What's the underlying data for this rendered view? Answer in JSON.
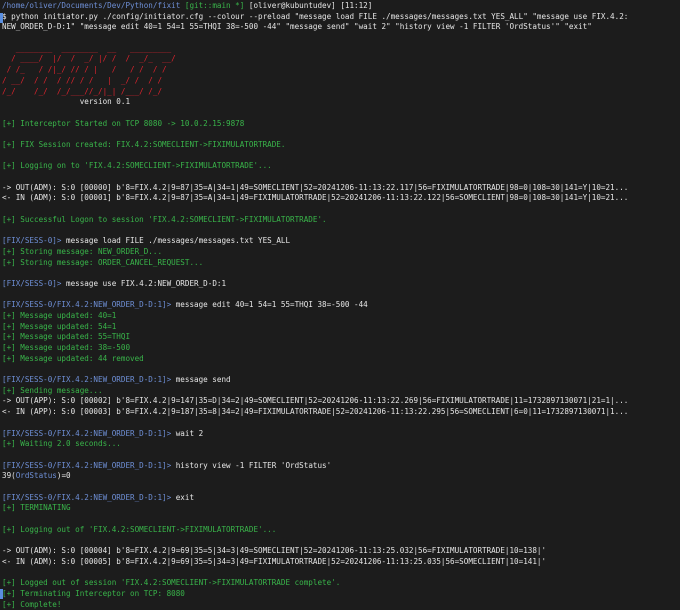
{
  "terminal": {
    "lines": [
      [
        {
          "t": "/home/oliver/Documents/Dev/Python/fixit",
          "c": "blue"
        },
        {
          "t": " [git::main *] ",
          "c": "green"
        },
        {
          "t": "[oliver@kubuntudev] [11:12]",
          "c": "white"
        }
      ],
      [
        {
          "t": "$ python initiator.py ./config/initiator.cfg --colour --preload \"message load FILE ./messages/messages.txt YES_ALL\" \"message use FIX.4.2:",
          "c": "white"
        }
      ],
      [
        {
          "t": "NEW_ORDER_D-D:1\" \"message edit 40=1 54=1 55=THQI 38=-500 -44\" \"message send\" \"wait 2\" \"history view -1 FILTER 'OrdStatus'\" \"exit\"",
          "c": "white"
        }
      ],
      [],
      [
        {
          "t": "   ________  ________  __   _________",
          "c": "red"
        }
      ],
      [
        {
          "t": "  / ____/  |/  /  _/ |/ /  /  _/_  __/",
          "c": "red"
        }
      ],
      [
        {
          "t": " / /_   / /|_/ // / |   /   / /  / /",
          "c": "red"
        }
      ],
      [
        {
          "t": "/ __/  / /  / // / /   |  _/ /  / /",
          "c": "red"
        }
      ],
      [
        {
          "t": "/_/    /_/  /_/___//_/|_| /___/ /_/",
          "c": "red"
        }
      ],
      [
        {
          "t": "                 version 0.1",
          "c": "white"
        }
      ],
      [],
      [
        {
          "t": "[+] Interceptor Started on TCP 8080 -> 10.0.2.15:9878",
          "c": "green"
        }
      ],
      [],
      [
        {
          "t": "[+] FIX Session created: FIX.4.2:SOMECLIENT->FIXIMULATORTRADE.",
          "c": "green"
        }
      ],
      [],
      [
        {
          "t": "[+] Logging on to 'FIX.4.2:SOMECLIENT->FIXIMULATORTRADE'...",
          "c": "green"
        }
      ],
      [],
      [
        {
          "t": "-> OUT(ADM): S:0 [00000] b'8=FIX.4.2|9=87|35=A|34=1|49=SOMECLIENT|52=20241206-11:13:22.117|56=FIXIMULATORTRADE|98=0|108=30|141=Y|10=21...",
          "c": "white"
        }
      ],
      [
        {
          "t": "<- IN (ADM): S:0 [00001] b'8=FIX.4.2|9=87|35=A|34=1|49=FIXIMULATORTRADE|52=20241206-11:13:22.122|56=SOMECLIENT|98=0|108=30|141=Y|10=21...",
          "c": "white"
        }
      ],
      [],
      [
        {
          "t": "[+] Successful Logon to session 'FIX.4.2:SOMECLIENT->FIXIMULATORTRADE'.",
          "c": "green"
        }
      ],
      [],
      [
        {
          "t": "[FIX/SESS-0]> ",
          "c": "blue"
        },
        {
          "t": "message load FILE ./messages/messages.txt YES_ALL",
          "c": "white"
        }
      ],
      [
        {
          "t": "[+] Storing message: NEW_ORDER_D...",
          "c": "green"
        }
      ],
      [
        {
          "t": "[+] Storing message: ORDER_CANCEL_REQUEST...",
          "c": "green"
        }
      ],
      [],
      [
        {
          "t": "[FIX/SESS-0]> ",
          "c": "blue"
        },
        {
          "t": "message use FIX.4.2:NEW_ORDER_D-D:1",
          "c": "white"
        }
      ],
      [],
      [
        {
          "t": "[FIX/SESS-0/FIX.4.2:NEW_ORDER_D-D:1]> ",
          "c": "blue"
        },
        {
          "t": "message edit 40=1 54=1 55=THQI 38=-500 -44",
          "c": "white"
        }
      ],
      [
        {
          "t": "[+] Message updated: 40=1",
          "c": "green"
        }
      ],
      [
        {
          "t": "[+] Message updated: 54=1",
          "c": "green"
        }
      ],
      [
        {
          "t": "[+] Message updated: 55=THQI",
          "c": "green"
        }
      ],
      [
        {
          "t": "[+] Message updated: 38=-500",
          "c": "green"
        }
      ],
      [
        {
          "t": "[+] Message updated: 44 removed",
          "c": "green"
        }
      ],
      [],
      [
        {
          "t": "[FIX/SESS-0/FIX.4.2:NEW_ORDER_D-D:1]> ",
          "c": "blue"
        },
        {
          "t": "message send",
          "c": "white"
        }
      ],
      [
        {
          "t": "[+] Sending message...",
          "c": "green"
        }
      ],
      [
        {
          "t": "-> OUT(APP): S:0 [00002] b'8=FIX.4.2|9=147|35=D|34=2|49=SOMECLIENT|52=20241206-11:13:22.269|56=FIXIMULATORTRADE|11=1732897130071|21=1|...",
          "c": "white"
        }
      ],
      [
        {
          "t": "<- IN (APP): S:0 [00003] b'8=FIX.4.2|9=187|35=8|34=2|49=FIXIMULATORTRADE|52=20241206-11:13:22.295|56=SOMECLIENT|6=0|11=1732897130071|1...",
          "c": "white"
        }
      ],
      [],
      [
        {
          "t": "[FIX/SESS-0/FIX.4.2:NEW_ORDER_D-D:1]> ",
          "c": "blue"
        },
        {
          "t": "wait 2",
          "c": "white"
        }
      ],
      [
        {
          "t": "[+] Waiting 2.0 seconds...",
          "c": "green"
        }
      ],
      [],
      [
        {
          "t": "[FIX/SESS-0/FIX.4.2:NEW_ORDER_D-D:1]> ",
          "c": "blue"
        },
        {
          "t": "history view -1 FILTER 'OrdStatus'",
          "c": "white"
        }
      ],
      [
        {
          "t": "39(",
          "c": "white"
        },
        {
          "t": "OrdStatus",
          "c": "blue"
        },
        {
          "t": ")=0",
          "c": "white"
        }
      ],
      [],
      [
        {
          "t": "[FIX/SESS-0/FIX.4.2:NEW_ORDER_D-D:1]> ",
          "c": "blue"
        },
        {
          "t": "exit",
          "c": "white"
        }
      ],
      [
        {
          "t": "[+] TERMINATING",
          "c": "green"
        }
      ],
      [],
      [
        {
          "t": "[+] Logging out of 'FIX.4.2:SOMECLIENT->FIXIMULATORTRADE'...",
          "c": "green"
        }
      ],
      [],
      [
        {
          "t": "-> OUT(ADM): S:0 [00004] b'8=FIX.4.2|9=69|35=5|34=3|49=SOMECLIENT|52=20241206-11:13:25.032|56=FIXIMULATORTRADE|10=138|'",
          "c": "white"
        }
      ],
      [
        {
          "t": "<- IN (ADM): S:0 [00005] b'8=FIX.4.2|9=69|35=5|34=3|49=FIXIMULATORTRADE|52=20241206-11:13:25.035|56=SOMECLIENT|10=141|'",
          "c": "white"
        }
      ],
      [],
      [
        {
          "t": "[+] Logged out of session 'FIX.4.2:SOMECLIENT->FIXIMULATORTRADE complete'.",
          "c": "green"
        }
      ],
      [
        {
          "t": "[+] Terminating Interceptor on TCP: 8080",
          "c": "green"
        }
      ],
      [
        {
          "t": "[+] Complete!",
          "c": "green"
        }
      ]
    ]
  },
  "colors": {
    "background": "#1c1c1c",
    "path": "#6e8fd6",
    "prompt": "#6e8fd6",
    "success": "#39b54a",
    "text": "#e6e6e6",
    "logo": "#e0242e",
    "cursor": "#5b8fe0"
  }
}
